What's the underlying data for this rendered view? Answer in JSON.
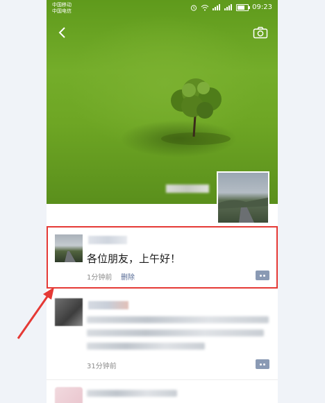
{
  "status_bar": {
    "carrier_1": "中国移动",
    "carrier_2": "中国电信",
    "time": "09:23"
  },
  "posts": [
    {
      "text": "各位朋友，上午好！",
      "time": "1分钟前",
      "delete_label": "删除"
    },
    {
      "time": "31分钟前"
    }
  ],
  "colors": {
    "link": "#576b95",
    "highlight": "#e53935",
    "comment_button": "#8a9ab4"
  },
  "icons": [
    "back-arrow-icon",
    "camera-icon",
    "comment-dots-icon"
  ]
}
